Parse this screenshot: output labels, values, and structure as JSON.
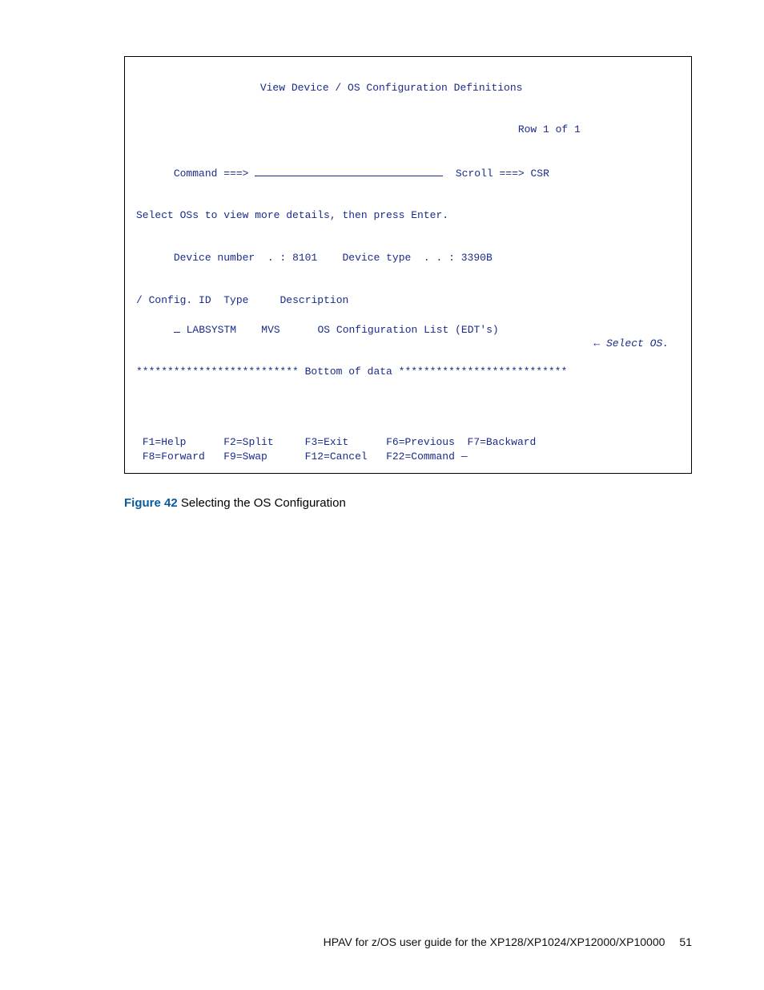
{
  "terminal": {
    "title": "View Device / OS Configuration Definitions",
    "row_info": "Row 1 of 1",
    "command_label": "Command ===>",
    "scroll_label": "Scroll ===> CSR",
    "instruction": "Select OSs to view more details, then press Enter.",
    "device_number_label": "Device number  . :",
    "device_number": "8101",
    "device_type_label": "Device type  . . :",
    "device_type": "3390B",
    "columns": {
      "sel": "/",
      "config_id": "Config. ID",
      "type": "Type",
      "description": "Description"
    },
    "row": {
      "config_id": "LABSYSTM",
      "type": "MVS",
      "description": "OS Configuration List (EDT's)"
    },
    "annotation_arrow": "←",
    "annotation_text": "Select OS.",
    "bottom_marker": "************************** Bottom of data ***************************",
    "fkeys_line1": {
      "f1": "F1=Help",
      "f2": "F2=Split",
      "f3": "F3=Exit",
      "f6": "F6=Previous",
      "f7": "F7=Backward"
    },
    "fkeys_line2": {
      "f8": "F8=Forward",
      "f9": "F9=Swap",
      "f12": "F12=Cancel",
      "f22": "F22=Command —"
    }
  },
  "caption": {
    "label": "Figure 42",
    "text": "  Selecting the OS Configuration"
  },
  "footer": {
    "text": "HPAV for z/OS user guide for the XP128/XP1024/XP12000/XP10000",
    "page": "51"
  }
}
